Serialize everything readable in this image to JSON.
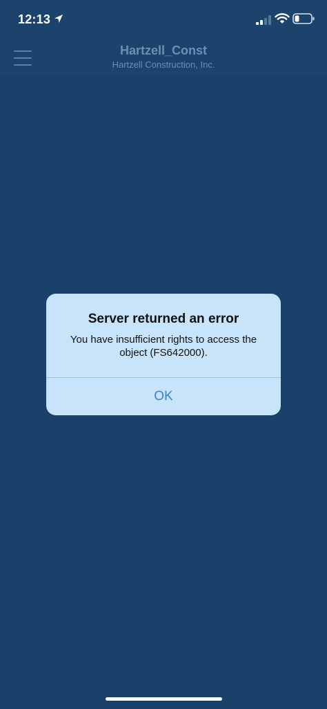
{
  "status_bar": {
    "time": "12:13",
    "icons": [
      "location-arrow-icon",
      "cellular-signal-icon",
      "wifi-icon",
      "battery-icon"
    ]
  },
  "nav": {
    "title": "Hartzell_Const",
    "subtitle": "Hartzell Construction, Inc.",
    "menu_icon": "hamburger-menu-icon"
  },
  "alert": {
    "title": "Server returned an error",
    "message": "You have insufficient rights to access the object (FS642000).",
    "ok_label": "OK"
  },
  "colors": {
    "background": "#1a4169",
    "alert_background": "#c8e4fb",
    "alert_button": "#3a84c8",
    "nav_text": "#6b8eb3"
  }
}
